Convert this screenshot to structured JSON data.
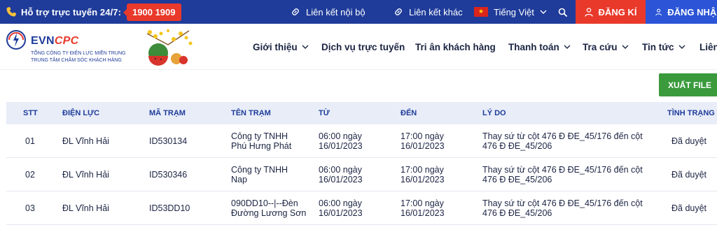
{
  "topbar": {
    "hotline_label": "Hỗ trợ trực tuyến 24/7:",
    "hotline_number": "1900 1909",
    "internal_link": "Liên kết nội bộ",
    "external_link": "Liên kết khác",
    "language": "Tiếng Việt",
    "register_label": "ĐĂNG KÍ",
    "login_label": "ĐĂNG NHẬP"
  },
  "logo": {
    "brand_evn": "EVN",
    "brand_cpc": "CPC",
    "line1": "TỔNG CÔNG TY ĐIỆN LỰC MIỀN TRUNG",
    "line2": "TRUNG TÂM CHĂM SÓC KHÁCH HÀNG"
  },
  "nav": {
    "items": [
      {
        "label": "Giới thiệu",
        "has_dropdown": true
      },
      {
        "label": "Dịch vụ trực tuyến",
        "has_dropdown": false
      },
      {
        "label": "Tri ân khách hàng",
        "has_dropdown": false
      },
      {
        "label": "Thanh toán",
        "has_dropdown": true
      },
      {
        "label": "Tra cứu",
        "has_dropdown": true
      },
      {
        "label": "Tin tức",
        "has_dropdown": true
      },
      {
        "label": "Liên",
        "has_dropdown": false
      }
    ]
  },
  "toolbar": {
    "export_label": "XUẤT FILE"
  },
  "table": {
    "headers": {
      "stt": "STT",
      "dien_luc": "ĐIỆN LỰC",
      "ma_tram": "MÃ TRẠM",
      "ten_tram": "TÊN TRẠM",
      "tu": "TỪ",
      "den": "ĐẾN",
      "ly_do": "LÝ DO",
      "tinh_trang": "TÌNH TRẠNG"
    },
    "rows": [
      {
        "stt": "01",
        "dien_luc": "ĐL Vĩnh Hải",
        "ma_tram": "ID530134",
        "ten_tram_1": "Công ty TNHH",
        "ten_tram_2": "Phú Hưng Phát",
        "tu_1": "06:00 ngày",
        "tu_2": "16/01/2023",
        "den_1": "17:00 ngày",
        "den_2": "16/01/2023",
        "ly_do_1": "Thay sứ từ cột 476 Đ ĐE_45/176 đến cột",
        "ly_do_2": "476 Đ ĐE_45/206",
        "tinh_trang": "Đã duyệt"
      },
      {
        "stt": "02",
        "dien_luc": "ĐL Vĩnh Hải",
        "ma_tram": "ID530346",
        "ten_tram_1": "Công ty TNHH",
        "ten_tram_2": "Nap",
        "tu_1": "06:00 ngày",
        "tu_2": "16/01/2023",
        "den_1": "17:00 ngày",
        "den_2": "16/01/2023",
        "ly_do_1": "Thay sứ từ cột 476 Đ ĐE_45/176 đến cột",
        "ly_do_2": "476 Đ ĐE_45/206",
        "tinh_trang": "Đã duyệt"
      },
      {
        "stt": "03",
        "dien_luc": "ĐL Vĩnh Hải",
        "ma_tram": "ID53DD10",
        "ten_tram_1": "090DD10--|--Đèn",
        "ten_tram_2": "Đường Lương Sơn",
        "tu_1": "06:00 ngày",
        "tu_2": "16/01/2023",
        "den_1": "17:00 ngày",
        "den_2": "16/01/2023",
        "ly_do_1": "Thay sứ từ cột 476 Đ ĐE_45/176 đến cột",
        "ly_do_2": "476 Đ ĐE_45/206",
        "tinh_trang": "Đã duyệt"
      }
    ]
  },
  "colors": {
    "topbar_bg": "#1f3c9a",
    "accent_red": "#e8392b",
    "login_blue": "#2b55d6",
    "export_green": "#3a9a3c",
    "table_header_bg": "#e8edf8"
  }
}
